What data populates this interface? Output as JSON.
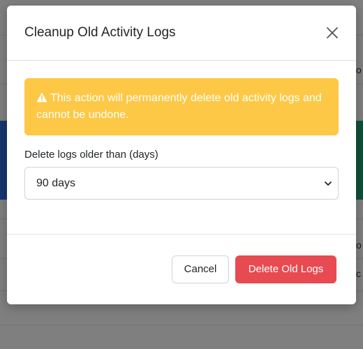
{
  "background": {
    "peek_texts": [
      "o",
      "o",
      "c"
    ]
  },
  "modal": {
    "title": "Cleanup Old Activity Logs",
    "close_icon": "close-icon",
    "alert": {
      "icon": "warning-triangle-icon",
      "text": "This action will permanently delete old activity logs and cannot be undone.",
      "color": "#fcc846"
    },
    "field": {
      "label": "Delete logs older than (days)",
      "selected": "90 days"
    },
    "buttons": {
      "cancel": "Cancel",
      "delete": "Delete Old Logs",
      "delete_color": "#e74a51"
    }
  }
}
